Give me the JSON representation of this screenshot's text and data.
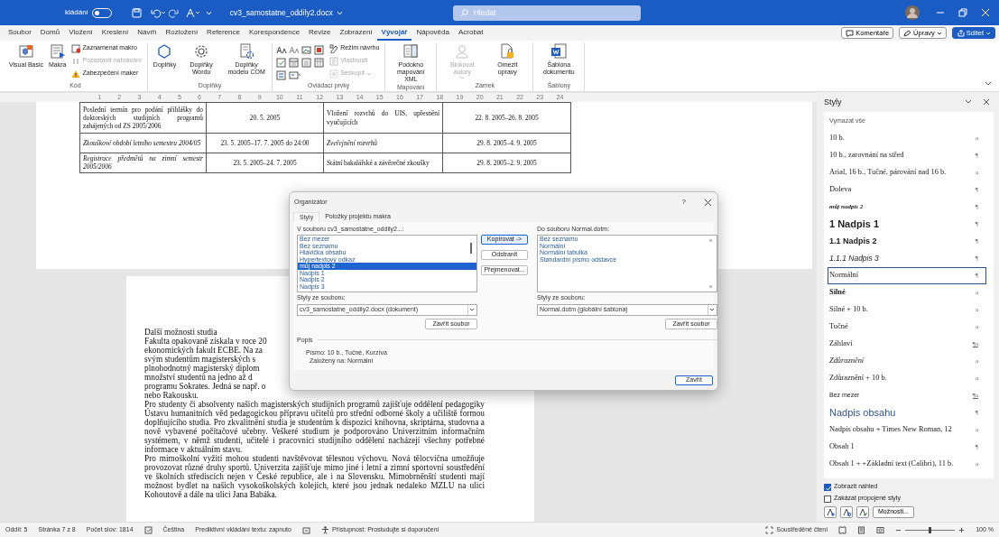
{
  "title_bar": {
    "autosave_label": "kládání",
    "autosave_on": false,
    "document_title": "cv3_samostatne_oddily2.docx",
    "search_placeholder": "Hledat"
  },
  "menu_tabs": [
    {
      "label": "Soubor",
      "selected": false
    },
    {
      "label": "Domů",
      "selected": false
    },
    {
      "label": "Vložení",
      "selected": false
    },
    {
      "label": "Kreslení",
      "selected": false
    },
    {
      "label": "Návrh",
      "selected": false
    },
    {
      "label": "Rozložení",
      "selected": false
    },
    {
      "label": "Reference",
      "selected": false
    },
    {
      "label": "Korespondence",
      "selected": false
    },
    {
      "label": "Revize",
      "selected": false
    },
    {
      "label": "Zobrazení",
      "selected": false
    },
    {
      "label": "Vývojář",
      "selected": true
    },
    {
      "label": "Nápověda",
      "selected": false
    },
    {
      "label": "Acrobat",
      "selected": false
    }
  ],
  "menu_actions": [
    {
      "label": "Komentáře",
      "kind": "comments"
    },
    {
      "label": "Úpravy",
      "kind": "editing"
    },
    {
      "label": "Sdílet",
      "kind": "share"
    }
  ],
  "ribbon_groups": [
    {
      "label": "Kód",
      "items": [
        {
          "label": "Visual Basic",
          "kind": "large",
          "disabled": false
        },
        {
          "label": "Makra",
          "kind": "large",
          "disabled": false
        },
        {
          "label": "Zaznamenat makro",
          "kind": "small",
          "disabled": false
        },
        {
          "label": "Pozastavit nahrávání",
          "kind": "small",
          "disabled": true
        },
        {
          "label": "Zabezpečení maker",
          "kind": "small",
          "disabled": false
        }
      ]
    },
    {
      "label": "Doplňky",
      "items": [
        {
          "label": "Doplňky",
          "kind": "large",
          "disabled": false
        },
        {
          "label": "Doplňky Wordu",
          "kind": "large",
          "disabled": false
        },
        {
          "label": "Doplňky modelu COM",
          "kind": "large",
          "disabled": false
        }
      ]
    },
    {
      "label": "Ovládací prvky",
      "items": [
        {
          "kind": "icon_grid",
          "disabled": false
        },
        {
          "label": "Režim návrhu",
          "kind": "small",
          "disabled": false
        },
        {
          "label": "Vlastnosti",
          "kind": "small",
          "disabled": true
        },
        {
          "label": "Seskupit",
          "kind": "small",
          "disabled": true,
          "dropdown": true
        }
      ]
    },
    {
      "label": "Mapování",
      "items": [
        {
          "label": "Podokno mapování XML",
          "kind": "large",
          "disabled": false
        }
      ]
    },
    {
      "label": "Zámek",
      "items": [
        {
          "label": "Blokovat autory",
          "kind": "large",
          "disabled": true,
          "dropdown": true
        },
        {
          "label": "Omezit úpravy",
          "kind": "large",
          "disabled": false
        }
      ]
    },
    {
      "label": "Šablony",
      "items": [
        {
          "label": "Šablona dokumentu",
          "kind": "large",
          "disabled": false
        }
      ]
    }
  ],
  "ruler_numbers": [
    "1",
    "2",
    "3",
    "4",
    "5",
    "6",
    "7",
    "8",
    "9",
    "10",
    "11",
    "12",
    "13",
    "14",
    "15",
    "16",
    "17",
    "18",
    "19",
    "20",
    "21",
    "22",
    "23",
    "24"
  ],
  "table_rows": [
    [
      {
        "text": "Poslední termín pro podání přihlášky do doktorských studijních programů zahájených od ZS 2005/2006",
        "italic": false
      },
      {
        "text": "20. 5. 2005",
        "italic": false
      },
      {
        "text": "Vložení rozvrhů do UIS, upřesnění vyučujících",
        "italic": false
      },
      {
        "text": "22. 8. 2005–26. 8. 2005",
        "italic": false
      }
    ],
    [
      {
        "text": "Zkouškové období letního semestru 2004/05",
        "italic": true
      },
      {
        "text": "23. 5. 2005–17. 7. 2005 do 24:00",
        "italic": false
      },
      {
        "text": "Zveřejnění rozvrhů",
        "italic": true
      },
      {
        "text": "29. 8. 2005–4. 9. 2005",
        "italic": false
      }
    ],
    [
      {
        "text": "Registrace předmětů na zimní semestr 2005/2006",
        "italic": true
      },
      {
        "text": "23. 5. 2005–24. 7. 2005",
        "italic": false
      },
      {
        "text": "Státní bakalářské a závěrečné zkoušky",
        "italic": false
      },
      {
        "text": "29. 8. 2005–2. 9. 2005",
        "italic": false
      }
    ]
  ],
  "page2": {
    "heading": "Další možnosti studia",
    "clipped_lines": [
      "Fakulta opakovaně získala v roce 20",
      "ekonomických fakult ECBE. Na za",
      "svým studentům magisterských s",
      "plnohodnotný magisterský diplom",
      "množství studentů na jedno až d",
      "programu Sokrates. Jedná se např. o"
    ],
    "clipped_tail": "nebo Rakousku.",
    "paragraphs": [
      "Pro studenty či absolventy našich magisterských studijních programů zajišťuje oddělení pedagogiky Ústavu humanitních věd pedagogickou přípravu učitelů pro střední odborné školy a učiliště formou doplňujícího studia. Pro zkvalitnění studia je studentům k dispozici knihovna, skriptárna, studovna a nově vybavené počítačové učebny. Veškeré studium je podporováno Univerzitním informačním systémem, v němž studenti, učitelé i pracovníci studijního oddělení nacházejí všechny potřebné informace v aktuálním stavu.",
      "Pro mimoškolní vyžití mohou studenti navštěvovat tělesnou výchovu. Nová tělocvična umožňuje provozovat různé druhy sportů. Univerzita zajišťuje mimo jiné i letní a zimní sportovní soustředění ve školních střediscích nejen v České republice, ale i na Slovensku. Mimobrněnští studenti mají možnost bydlet na našich vysokoškolských kolejích, které jsou jednak nedaleko MZLU na ulici Kohoutově a dále na ulici Jana Babáka."
    ]
  },
  "organizer_dialog": {
    "title": "Organizátor",
    "help": "?",
    "tabs": [
      {
        "label": "Styly",
        "selected": true
      },
      {
        "label": "Položky projektu makra",
        "selected": false
      }
    ],
    "left_label": "V souboru cv3_samostatne_oddily2...:",
    "left_items": [
      {
        "label": "Bez mezer",
        "selected": false
      },
      {
        "label": "Bez seznamu",
        "selected": false
      },
      {
        "label": "Hlavička obsahu",
        "selected": false
      },
      {
        "label": "Hypertextový odkaz",
        "selected": false
      },
      {
        "label": "můj nadpis 2",
        "selected": true
      },
      {
        "label": "Nadpis 1",
        "selected": false
      },
      {
        "label": "Nadpis 2",
        "selected": false
      },
      {
        "label": "Nadpis 3",
        "selected": false
      }
    ],
    "middle_buttons": [
      {
        "label": "Kopírovat ->",
        "default": true
      },
      {
        "label": "Odstranit",
        "default": false
      },
      {
        "label": "Přejmenovat...",
        "default": false
      }
    ],
    "right_label": "Do souboru Normal.dotm:",
    "right_items": [
      {
        "label": "Bez seznamu",
        "selected": false
      },
      {
        "label": "Normální",
        "selected": false
      },
      {
        "label": "Normální tabulka",
        "selected": false
      },
      {
        "label": "Standardní písmo odstavce",
        "selected": false
      }
    ],
    "left_source_label": "Styly ze souboru:",
    "left_source": "cv3_samostatne_oddily2.docx (dokument)",
    "left_close": "Zavřít soubor",
    "right_source_label": "Styly ze souboru:",
    "right_source": "Normal.dotm (globální šablona)",
    "right_close": "Zavřít soubor",
    "description_legend": "Popis",
    "description_lines": [
      "Písmo: 10 b., Tučné, Kurzíva",
      "Založený na: Normální"
    ],
    "close_button": "Zavřít"
  },
  "styles_pane": {
    "title": "Styly",
    "clear_all": "Vymazat vše",
    "items": [
      {
        "label": "10 b.",
        "kind": "serif",
        "mark": "a",
        "selected": false
      },
      {
        "label": "10 b., zarovnání na střed",
        "kind": "serif",
        "mark": "¶",
        "selected": false
      },
      {
        "label": "Arial, 16 b., Tučné, párování nad 16 b.",
        "kind": "serif",
        "mark": "a",
        "selected": false
      },
      {
        "label": "Doleva",
        "kind": "serif",
        "mark": "¶",
        "selected": false
      },
      {
        "label": "můj nadpis 2",
        "kind": "serif_bold_italic_small",
        "mark": "¶",
        "selected": false
      },
      {
        "label": "1  Nadpis 1",
        "kind": "heading1",
        "mark": "¶",
        "selected": false
      },
      {
        "label": "1.1  Nadpis 2",
        "kind": "heading2",
        "mark": "¶",
        "selected": false
      },
      {
        "label": "1.1.1  Nadpis 3",
        "kind": "heading3",
        "mark": "¶",
        "selected": false
      },
      {
        "label": "Normální",
        "kind": "serif",
        "mark": "¶",
        "selected": true
      },
      {
        "label": "Silné",
        "kind": "serif_bold",
        "mark": "a",
        "selected": false
      },
      {
        "label": "Silné + 10 b.",
        "kind": "serif",
        "mark": "a",
        "selected": false
      },
      {
        "label": "Tučné",
        "kind": "serif",
        "mark": "a",
        "selected": false
      },
      {
        "label": "Záhlaví",
        "kind": "serif",
        "mark": "¶a",
        "selected": false
      },
      {
        "label": "Zdůraznění",
        "kind": "serif_italic",
        "mark": "a",
        "selected": false
      },
      {
        "label": "Zdůraznění + 10 b.",
        "kind": "serif",
        "mark": "a",
        "selected": false
      },
      {
        "label": "Bez mezer",
        "kind": "sans_small",
        "mark": "¶a",
        "selected": false
      },
      {
        "label": "Nadpis obsahu",
        "kind": "toc_heading",
        "mark": "¶",
        "selected": false
      },
      {
        "label": "Nadpis obsahu + Times New Roman, 12",
        "kind": "serif",
        "mark": "a",
        "selected": false
      },
      {
        "label": "Obsah 1",
        "kind": "serif",
        "mark": "¶",
        "selected": false
      },
      {
        "label": "Obsah 1 + +Základní text (Calibri), 11 b.",
        "kind": "serif",
        "mark": "a",
        "selected": false
      }
    ],
    "options": [
      {
        "label": "Zobrazit náhled",
        "checked": true
      },
      {
        "label": "Zakázat propojené styly",
        "checked": false
      }
    ],
    "options_button": "Možnosti..."
  },
  "status_bar": {
    "left": [
      "Oddíl: 5",
      "Stránka 7 z 8",
      "Počet slov: 1814"
    ],
    "language": "Čeština",
    "predictive": "Prediktivní vkládání textu: zapnuto",
    "accessibility": "Přístupnost: Prostudujte si doporučení",
    "focus": "Soustředěné čtení",
    "zoom": {
      "level": 0.5,
      "reading": "100 %"
    }
  }
}
